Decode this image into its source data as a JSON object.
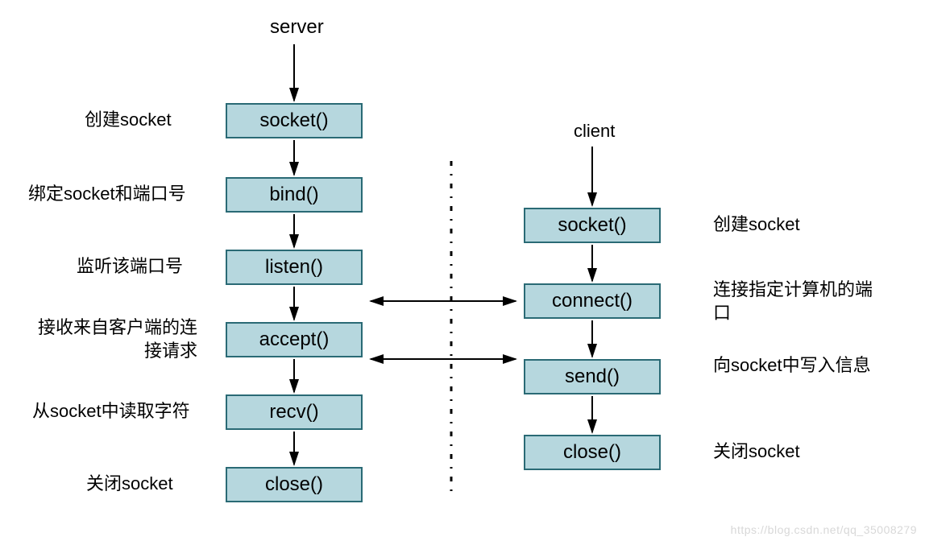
{
  "server": {
    "title": "server",
    "steps": [
      {
        "name": "socket()",
        "desc": "创建socket"
      },
      {
        "name": "bind()",
        "desc": "绑定socket和端口号"
      },
      {
        "name": "listen()",
        "desc": "监听该端口号"
      },
      {
        "name": "accept()",
        "desc": "接收来自客户端的连接请求"
      },
      {
        "name": "recv()",
        "desc": "从socket中读取字符"
      },
      {
        "name": "close()",
        "desc": "关闭socket"
      }
    ]
  },
  "client": {
    "title": "client",
    "steps": [
      {
        "name": "socket()",
        "desc": "创建socket"
      },
      {
        "name": "connect()",
        "desc": "连接指定计算机的端口"
      },
      {
        "name": "send()",
        "desc": "向socket中写入信息"
      },
      {
        "name": "close()",
        "desc": "关闭socket"
      }
    ]
  },
  "watermark": "https://blog.csdn.net/qq_35008279"
}
